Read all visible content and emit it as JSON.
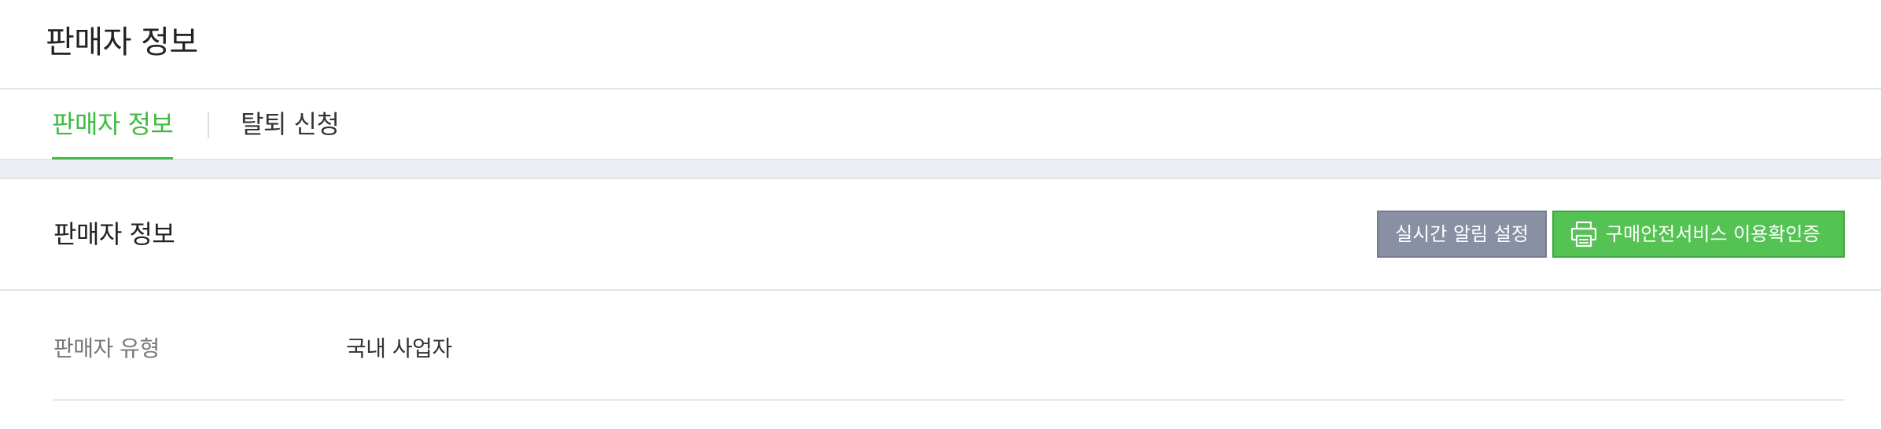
{
  "page": {
    "title": "판매자 정보"
  },
  "tabs": [
    {
      "label": "판매자 정보",
      "active": true
    },
    {
      "label": "탈퇴 신청",
      "active": false
    }
  ],
  "section": {
    "title": "판매자 정보",
    "buttons": {
      "alert_label": "실시간 알림 설정",
      "verify_label": "구매안전서비스 이용확인증",
      "verify_icon": "printer-icon"
    }
  },
  "info_rows": [
    {
      "label": "판매자 유형",
      "value": "국내 사업자"
    }
  ],
  "colors": {
    "accent": "#3fbb42",
    "alert_button": "#8a90a3",
    "verify_button": "#55c254"
  }
}
